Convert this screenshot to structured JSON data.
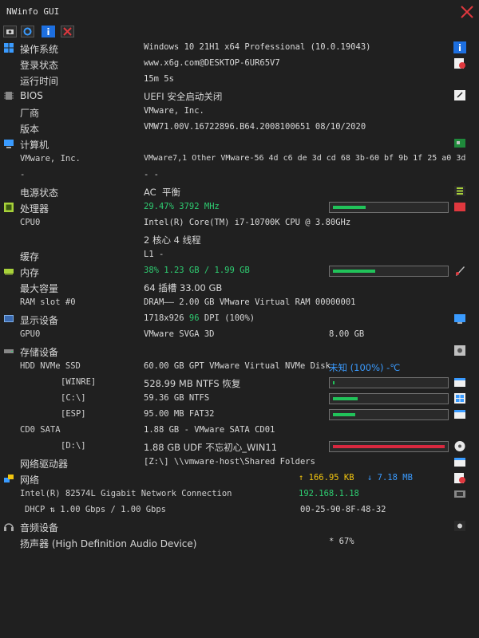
{
  "window": {
    "title": "NWinfo GUI"
  },
  "colors": {
    "bar_green": "#21c35a",
    "bar_red": "#d8283f",
    "close_red": "#e0383e"
  },
  "rows": {
    "os": {
      "label": "操作系统",
      "value": "Windows 10 21H1 x64 Professional (10.0.19043)"
    },
    "login": {
      "label": "登录状态",
      "value": "www.x6g.com@DESKTOP-6UR65V7"
    },
    "uptime": {
      "label": "运行时间",
      "value": "15m 5s"
    },
    "bios": {
      "label": "BIOS",
      "value": "UEFI 安全启动关闭"
    },
    "vendor": {
      "label": "厂商",
      "value": "VMware, Inc."
    },
    "version": {
      "label": "版本",
      "value": "VMW71.00V.16722896.B64.2008100651 08/10/2020"
    },
    "computer": {
      "label": "计算机"
    },
    "sysvendor": {
      "label": "VMware, Inc.",
      "value": "VMware7,1 Other VMware-56 4d c6 de 3d cd 68 3b-60 bf 9b 1f 25 a0 3d"
    },
    "dash": {
      "label": "-",
      "value": "- -"
    },
    "power": {
      "label": "电源状态",
      "value_a": "AC",
      "value_b": "平衡"
    },
    "cpu": {
      "label": "处理器",
      "usage": "29.47%",
      "freq": "3792 MHz",
      "usage_fraction": 0.29
    },
    "cpu0": {
      "label": "CPU0",
      "value": "Intel(R) Core(TM) i7-10700K CPU @ 3.80GHz"
    },
    "cores": {
      "value": "2 核心 4 线程"
    },
    "cache": {
      "label": "缓存",
      "value": "L1 -"
    },
    "memory": {
      "label": "内存",
      "percent": "38%",
      "value": "1.23 GB / 1.99 GB",
      "usage_fraction": 0.38
    },
    "maxcap": {
      "label": "最大容量",
      "value": "64 插槽 33.00 GB"
    },
    "ramslot": {
      "label": "RAM slot #0",
      "value": "DRAM—— 2.00 GB VMware Virtual RAM 00000001"
    },
    "display": {
      "label": "显示设备",
      "res": "1718x926",
      "dpi": "96",
      "dpi_unit": "DPI",
      "scale": "(100%)"
    },
    "gpu0": {
      "label": "GPU0",
      "value": "VMware SVGA 3D",
      "vram": "8.00 GB"
    },
    "storage": {
      "label": "存储设备"
    },
    "hdd0": {
      "label": "HDD NVMe SSD",
      "value": "60.00 GB GPT VMware Virtual NVMe Disk",
      "health": "未知 (100%)",
      "temp": "-℃"
    },
    "winre": {
      "label": "[WINRE]",
      "value": "528.99 MB NTFS 恢复",
      "usage_fraction": 0.01
    },
    "cdrive": {
      "label": "[C:\\]",
      "value": "59.36 GB NTFS",
      "usage_fraction": 0.22
    },
    "esp": {
      "label": "[ESP]",
      "value": "95.00 MB FAT32",
      "usage_fraction": 0.2
    },
    "cd0": {
      "label": "CD0 SATA",
      "value": "1.88 GB - VMware SATA CD01"
    },
    "ddrive": {
      "label": "[D:\\]",
      "value": "1.88 GB UDF 不忘初心_WIN11",
      "usage_fraction": 1.0
    },
    "netdrive": {
      "label": "网络驱动器",
      "value": "[Z:\\] \\\\vmware-host\\Shared Folders"
    },
    "network": {
      "label": "网络",
      "up_arrow": "↑",
      "up": "166.95 KB",
      "down_arrow": "↓",
      "down": "7.18 MB"
    },
    "nic": {
      "label": "Intel(R) 82574L Gigabit Network Connection",
      "ip": "192.168.1.18"
    },
    "dhcp": {
      "label": "DHCP ⇅ 1.00 Gbps / 1.00 Gbps",
      "mac": "00-25-90-8F-48-32"
    },
    "audio": {
      "label": "音频设备"
    },
    "speaker": {
      "label": "扬声器 (High Definition Audio Device)",
      "volume": "* 67%"
    }
  }
}
